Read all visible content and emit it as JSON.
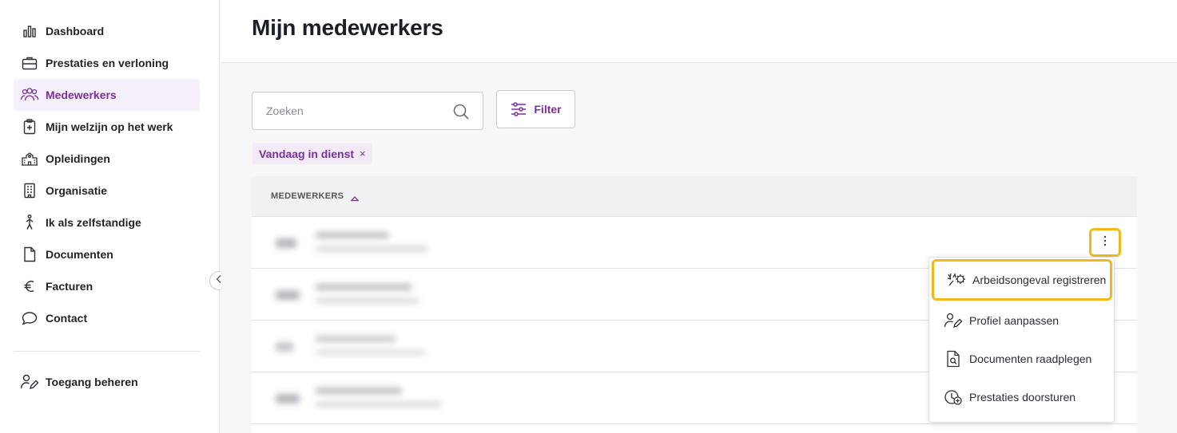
{
  "sidebar": {
    "items": [
      {
        "label": "Dashboard",
        "icon": "bar-chart-icon"
      },
      {
        "label": "Prestaties en verloning",
        "icon": "briefcase-icon"
      },
      {
        "label": "Medewerkers",
        "icon": "users-icon"
      },
      {
        "label": "Mijn welzijn op het werk",
        "icon": "clipboard-plus-icon"
      },
      {
        "label": "Opleidingen",
        "icon": "school-building-icon"
      },
      {
        "label": "Organisatie",
        "icon": "building-icon"
      },
      {
        "label": "Ik als zelfstandige",
        "icon": "person-walking-icon"
      },
      {
        "label": "Documenten",
        "icon": "document-icon"
      },
      {
        "label": "Facturen",
        "icon": "euro-icon"
      },
      {
        "label": "Contact",
        "icon": "chat-bubble-icon"
      }
    ],
    "bottom": {
      "label": "Toegang beheren",
      "icon": "user-edit-icon"
    },
    "active_color": "#7b2f9e",
    "active_bg": "#f6effc"
  },
  "header": {
    "title": "Mijn medewerkers"
  },
  "search": {
    "placeholder": "Zoeken"
  },
  "filter": {
    "label": "Filter"
  },
  "chip": {
    "label": "Vandaag in dienst",
    "remove": "×"
  },
  "table": {
    "column": "MEDEWERKERS"
  },
  "menu": {
    "items": [
      {
        "label": "Arbeidsongeval registreren",
        "icon": "accident-icon"
      },
      {
        "label": "Profiel aanpassen",
        "icon": "user-edit-icon"
      },
      {
        "label": "Documenten raadplegen",
        "icon": "document-search-icon"
      },
      {
        "label": "Prestaties doorsturen",
        "icon": "clock-send-icon"
      }
    ]
  },
  "colors": {
    "highlight": "#f0b81c",
    "accent": "#7b2f9e"
  }
}
